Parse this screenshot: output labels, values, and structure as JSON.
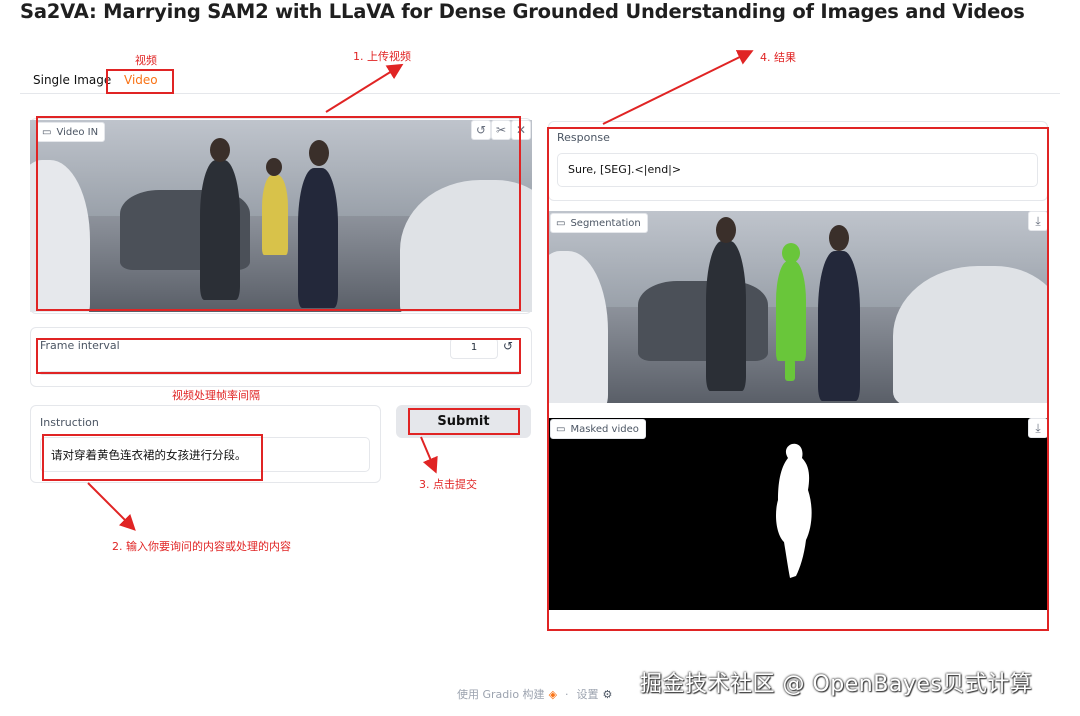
{
  "page": {
    "title": "Sa2VA: Marrying SAM2 with LLaVA for Dense Grounded Understanding of Images and Videos"
  },
  "tabs": [
    {
      "label": "Single Image",
      "selected": false
    },
    {
      "label": "Video",
      "selected": true
    }
  ],
  "left": {
    "video_in_label": "Video IN",
    "frame_interval": {
      "label": "Frame interval",
      "value": "1"
    },
    "instruction": {
      "label": "Instruction",
      "value": "请对穿着黄色连衣裙的女孩进行分段。"
    },
    "submit_label": "Submit"
  },
  "right": {
    "response": {
      "label": "Response",
      "value": "Sure, [SEG].<|end|>"
    },
    "segmentation_label": "Segmentation",
    "masked_video_label": "Masked video"
  },
  "annotations": {
    "video_tab": "视频",
    "step1": "1. 上传视频",
    "frame_interval_note": "视频处理帧率间隔",
    "step2": "2. 输入你要询问的内容或处理的内容",
    "step3": "3. 点击提交",
    "step4": "4. 结果"
  },
  "footer": {
    "built_with": "使用 Gradio 构建",
    "separator": "·",
    "settings": "设置"
  },
  "watermark": "掘金技术社区 @ OpenBayes贝式计算",
  "colors": {
    "accent": "#f97316",
    "annotation": "#e02424",
    "mask_highlight": "#69c63a"
  }
}
